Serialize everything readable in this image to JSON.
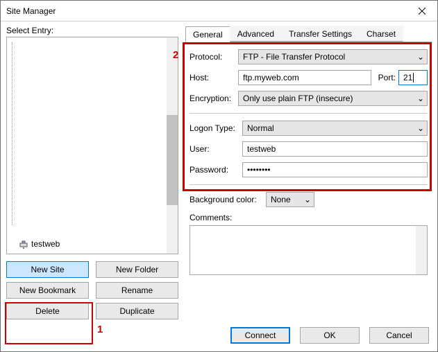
{
  "window": {
    "title": "Site Manager"
  },
  "left": {
    "select_label": "Select Entry:",
    "tree_item": "testweb",
    "buttons": {
      "new_site": "New Site",
      "new_folder": "New Folder",
      "new_bookmark": "New Bookmark",
      "rename": "Rename",
      "delete": "Delete",
      "duplicate": "Duplicate"
    },
    "annotation1": "1"
  },
  "tabs": {
    "general": "General",
    "advanced": "Advanced",
    "transfer": "Transfer Settings",
    "charset": "Charset"
  },
  "form": {
    "protocol_label": "Protocol:",
    "protocol_value": "FTP - File Transfer Protocol",
    "host_label": "Host:",
    "host_value": "ftp.myweb.com",
    "port_label": "Port:",
    "port_value": "21",
    "encryption_label": "Encryption:",
    "encryption_value": "Only use plain FTP (insecure)",
    "logon_label": "Logon Type:",
    "logon_value": "Normal",
    "user_label": "User:",
    "user_value": "testweb",
    "password_label": "Password:",
    "password_value": "••••••••",
    "bg_label": "Background color:",
    "bg_value": "None",
    "comments_label": "Comments:",
    "annotation2": "2"
  },
  "footer": {
    "connect": "Connect",
    "ok": "OK",
    "cancel": "Cancel"
  }
}
